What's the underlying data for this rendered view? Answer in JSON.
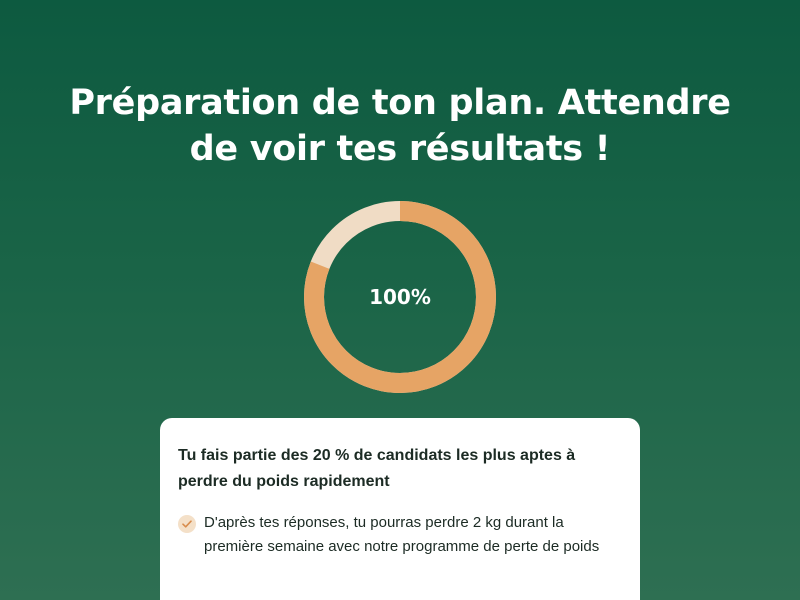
{
  "title": {
    "line1": "Préparation de ton plan. Attendre",
    "line2": "de voir tes résultats !"
  },
  "progress": {
    "label": "100%",
    "value": 100,
    "fill_fraction": 0.81,
    "fill_color": "#e6a465",
    "track_color": "#f0dcc5"
  },
  "card": {
    "heading": "Tu fais partie des 20 % de candidats les plus aptes à perdre du poids rapidement",
    "items": [
      {
        "icon": "check-icon",
        "text": "D'après tes réponses, tu pourras perdre 2 kg durant la première semaine avec notre programme de perte de poids"
      }
    ]
  },
  "colors": {
    "background_top": "#0d5a40",
    "background_bottom": "#2e6f52",
    "accent": "#e6a465"
  }
}
